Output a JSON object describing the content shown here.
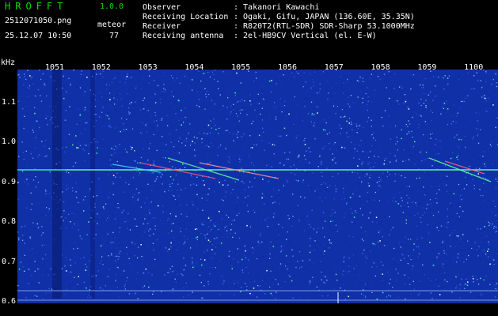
{
  "header": {
    "app_title": "HROFFT",
    "version": "1.0.0",
    "file_name": "2512071050.png",
    "timestamp": "25.12.07 10:50",
    "detection_type": "meteor",
    "detection_count": "77",
    "info": [
      {
        "label": "Observer",
        "value": ": Takanori Kawachi"
      },
      {
        "label": "Receiving Location",
        "value": ": Ogaki, Gifu, JAPAN (136.60E, 35.35N)"
      },
      {
        "label": "Receiver",
        "value": ": R820T2(RTL-SDR) SDR-Sharp 53.1000MHz"
      },
      {
        "label": "Receiving antenna",
        "value": ": 2el-HB9CV Vertical (el. E-W)"
      }
    ]
  },
  "axes": {
    "y_unit": "kHz",
    "x_ticks": [
      "1051",
      "1052",
      "1053",
      "1054",
      "1055",
      "1056",
      "1057",
      "1058",
      "1059",
      "1100"
    ],
    "y_ticks": [
      "1.1",
      "1.0",
      "0.9",
      "0.8",
      "0.7",
      "0.6"
    ]
  },
  "colors": {
    "background": "#000000",
    "header_green": "#00e000",
    "text": "#ffffff",
    "spectrum_base": "#1030a8",
    "carrier": "#40ff90",
    "amplitude": "#ffff00"
  }
}
